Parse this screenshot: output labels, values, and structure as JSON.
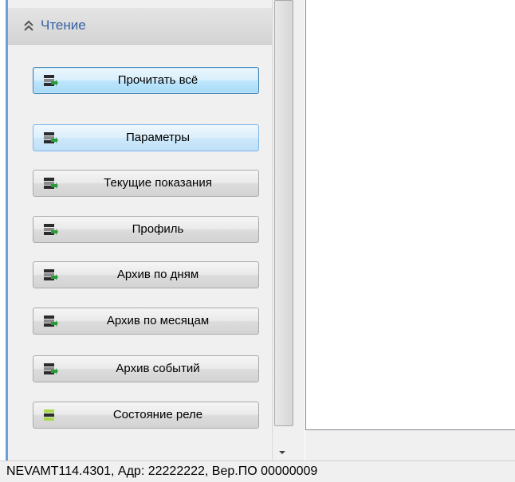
{
  "panel": {
    "title": "Чтение",
    "collapse_icon": "double-chevron-up-icon"
  },
  "buttons": [
    {
      "label": "Прочитать всё",
      "icon": "meter-read-icon",
      "state": "focused"
    },
    {
      "label": "Параметры",
      "icon": "meter-read-icon",
      "state": "selected"
    },
    {
      "label": "Текущие показания",
      "icon": "meter-read-icon",
      "state": "normal"
    },
    {
      "label": "Профиль",
      "icon": "meter-read-icon",
      "state": "normal"
    },
    {
      "label": "Архив по дням",
      "icon": "meter-read-icon",
      "state": "normal"
    },
    {
      "label": "Архив по месяцам",
      "icon": "meter-read-icon",
      "state": "normal"
    },
    {
      "label": "Архив событий",
      "icon": "meter-read-icon",
      "state": "normal"
    },
    {
      "label": "Состояние реле",
      "icon": "relay-state-icon",
      "state": "normal"
    }
  ],
  "status_bar": {
    "text": "NEVAMT114.4301, Адр: 22222222, Вер.ПО 00000009"
  },
  "colors": {
    "accent": "#3461a6",
    "window_border": "#6aa0d8",
    "icon_green": "#2a9d3a",
    "relay_green": "#a8d84a"
  }
}
